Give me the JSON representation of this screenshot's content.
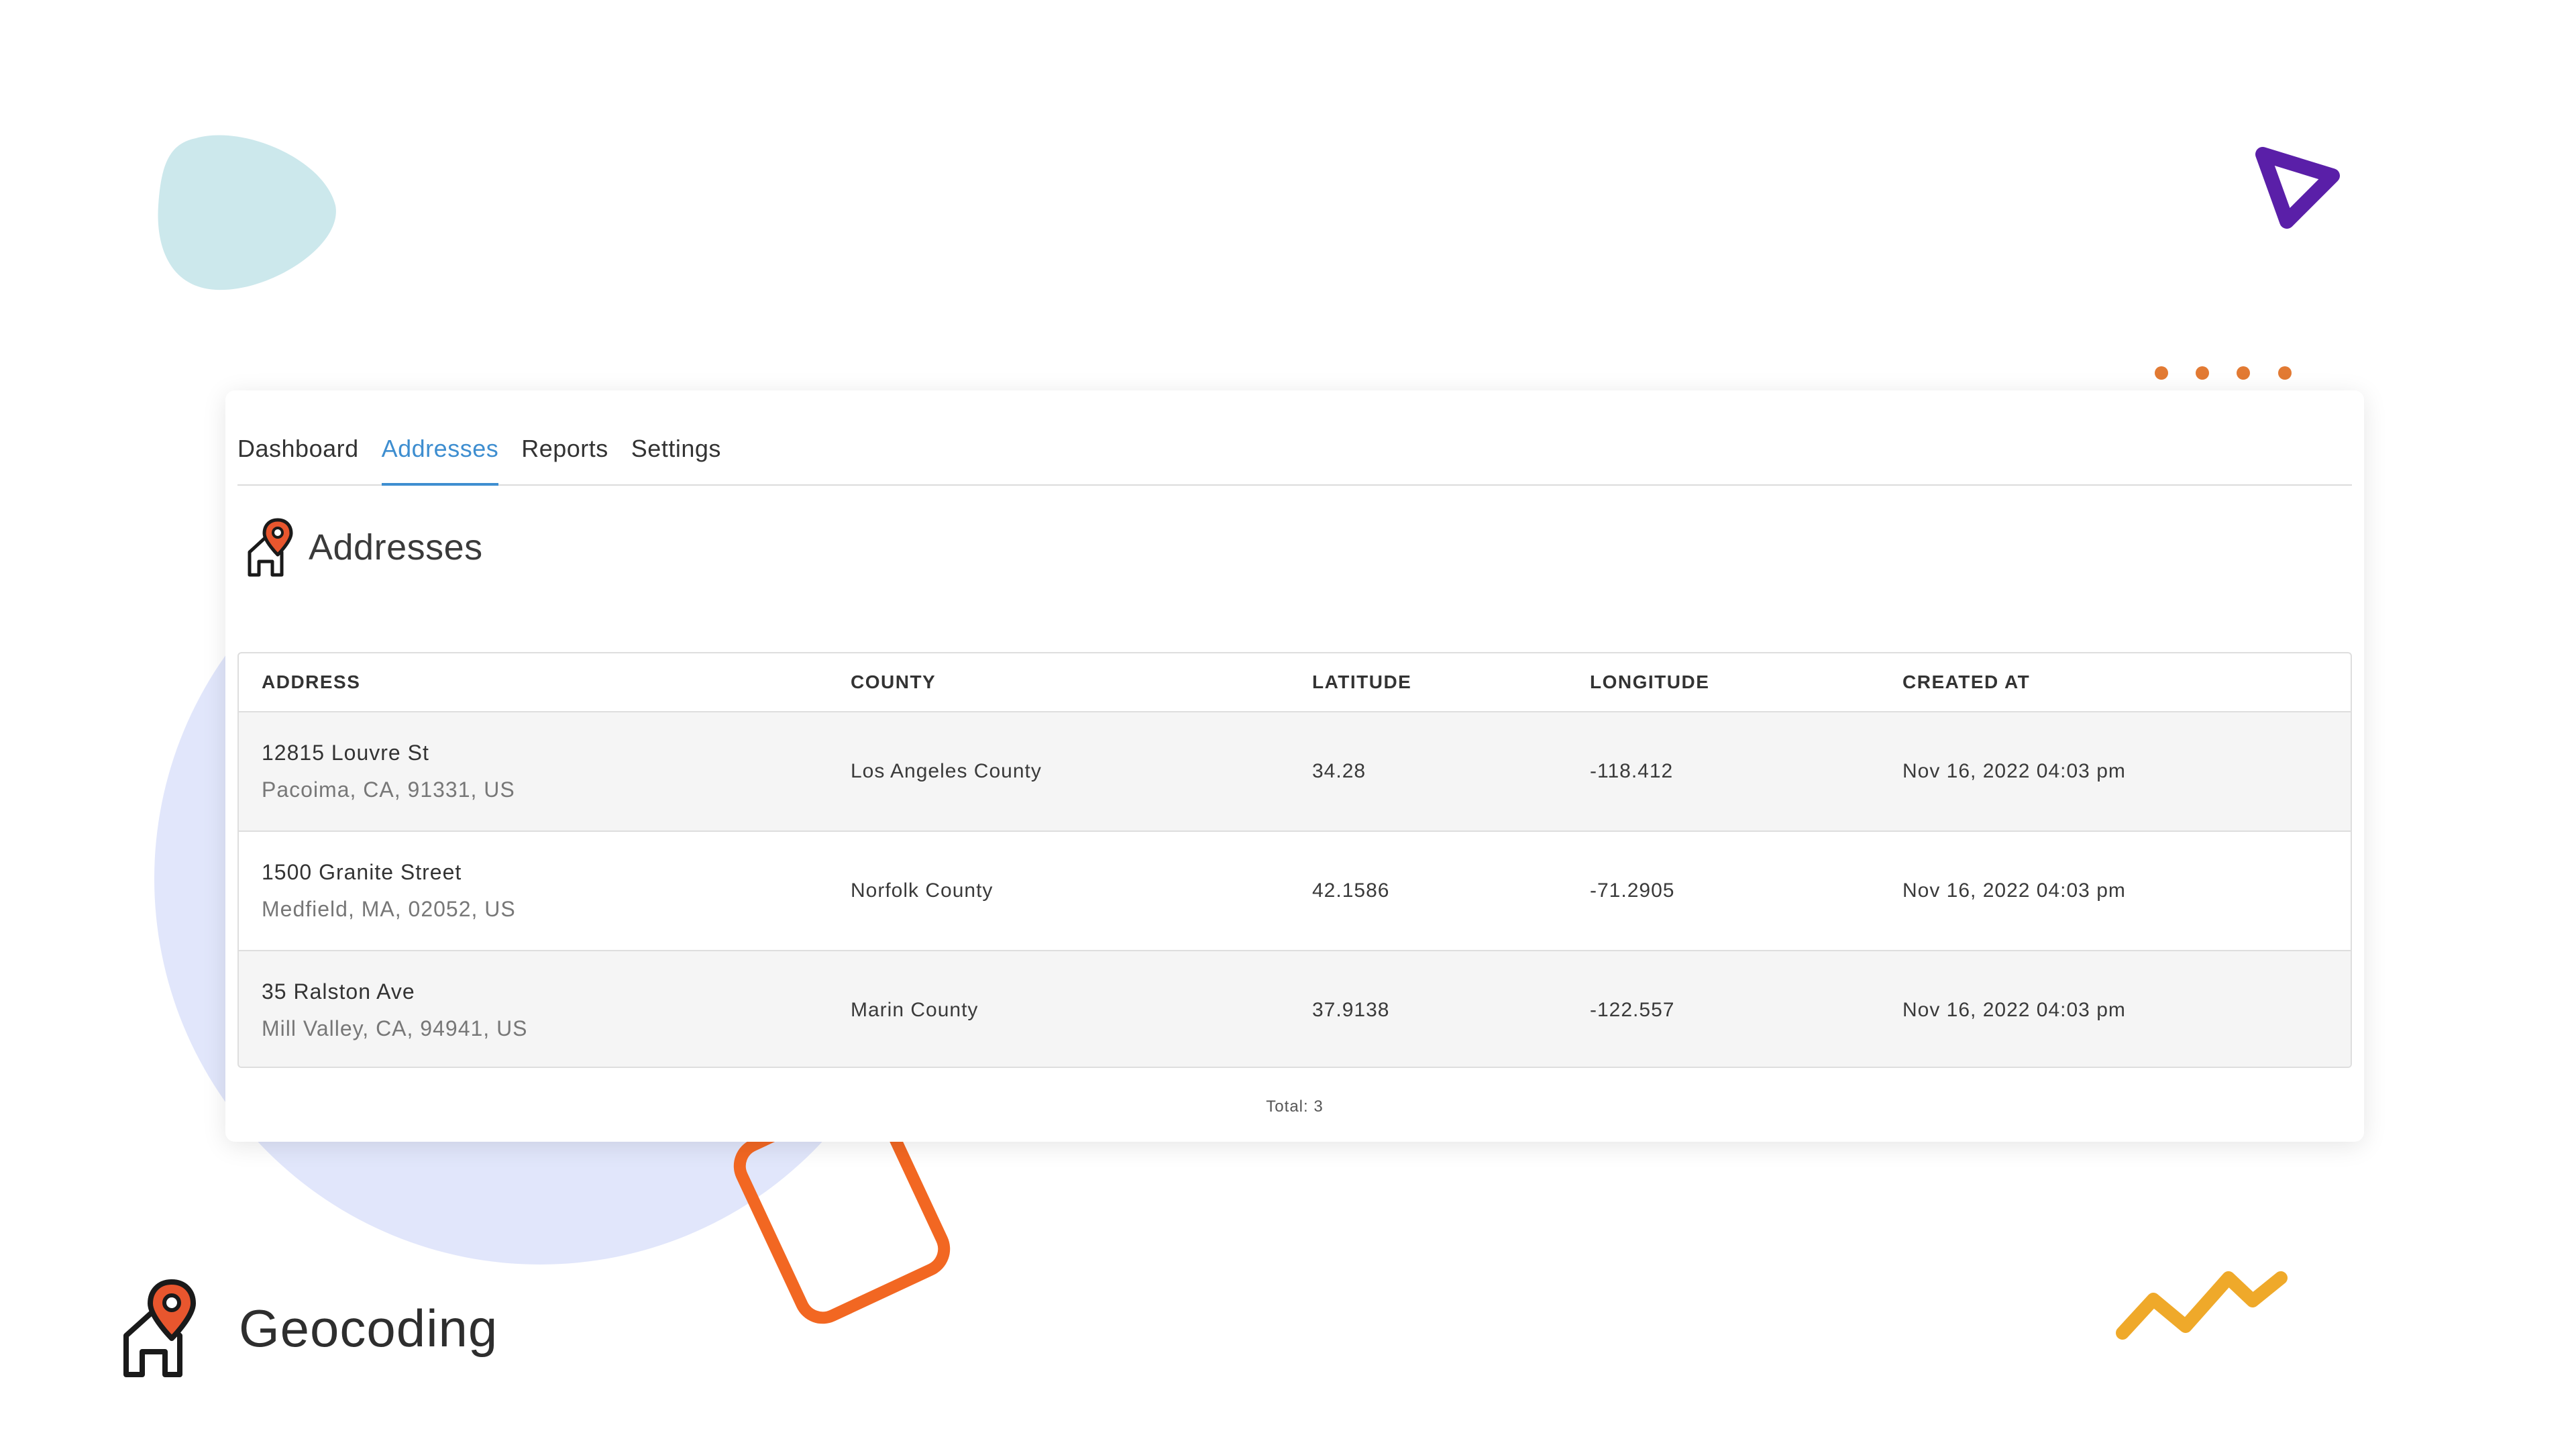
{
  "colors": {
    "accent": "#3e8ed0",
    "pin_orange": "#e8562e",
    "blob_teal": "#cce8ec",
    "circle_lavender": "#e1e6fb",
    "triangle_purple": "#5a1fa8",
    "dots_orange": "#e27a33",
    "square_orange": "#f26722",
    "zigzag_yellow": "#efa92a"
  },
  "nav": {
    "tabs": [
      {
        "label": "Dashboard",
        "active": false
      },
      {
        "label": "Addresses",
        "active": true
      },
      {
        "label": "Reports",
        "active": false
      },
      {
        "label": "Settings",
        "active": false
      }
    ]
  },
  "page": {
    "icon": "house-pin-icon",
    "title": "Addresses"
  },
  "table": {
    "columns": [
      "ADDRESS",
      "COUNTY",
      "LATITUDE",
      "LONGITUDE",
      "CREATED AT"
    ],
    "rows": [
      {
        "address_line1": "12815 Louvre St",
        "address_line2": "Pacoima, CA, 91331, US",
        "county": "Los Angeles County",
        "latitude": "34.28",
        "longitude": "-118.412",
        "created_at": "Nov 16, 2022 04:03 pm"
      },
      {
        "address_line1": "1500 Granite Street",
        "address_line2": "Medfield, MA, 02052, US",
        "county": "Norfolk County",
        "latitude": "42.1586",
        "longitude": "-71.2905",
        "created_at": "Nov 16, 2022 04:03 pm"
      },
      {
        "address_line1": "35 Ralston Ave",
        "address_line2": "Mill Valley, CA, 94941, US",
        "county": "Marin County",
        "latitude": "37.9138",
        "longitude": "-122.557",
        "created_at": "Nov 16, 2022 04:03 pm"
      }
    ],
    "total_label": "Total: 3"
  },
  "brand": {
    "icon": "house-pin-icon",
    "name": "Geocoding"
  }
}
